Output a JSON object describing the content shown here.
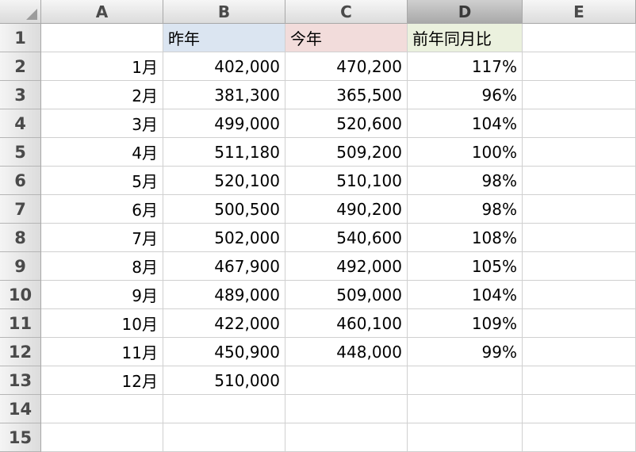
{
  "columns": [
    "A",
    "B",
    "C",
    "D",
    "E"
  ],
  "selected_column": "D",
  "header_row": {
    "a": "",
    "b": "昨年",
    "c": "今年",
    "d": "前年同月比",
    "e": ""
  },
  "header_fills": {
    "b": "#dbe5f1",
    "c": "#f2dcdb",
    "d": "#ebf1de"
  },
  "rows": [
    {
      "num": "2",
      "month": "1月",
      "last_year": "402,000",
      "this_year": "470,200",
      "yoy": "117%"
    },
    {
      "num": "3",
      "month": "2月",
      "last_year": "381,300",
      "this_year": "365,500",
      "yoy": "96%"
    },
    {
      "num": "4",
      "month": "3月",
      "last_year": "499,000",
      "this_year": "520,600",
      "yoy": "104%"
    },
    {
      "num": "5",
      "month": "4月",
      "last_year": "511,180",
      "this_year": "509,200",
      "yoy": "100%"
    },
    {
      "num": "6",
      "month": "5月",
      "last_year": "520,100",
      "this_year": "510,100",
      "yoy": "98%"
    },
    {
      "num": "7",
      "month": "6月",
      "last_year": "500,500",
      "this_year": "490,200",
      "yoy": "98%"
    },
    {
      "num": "8",
      "month": "7月",
      "last_year": "502,000",
      "this_year": "540,600",
      "yoy": "108%"
    },
    {
      "num": "9",
      "month": "8月",
      "last_year": "467,900",
      "this_year": "492,000",
      "yoy": "105%"
    },
    {
      "num": "10",
      "month": "9月",
      "last_year": "489,000",
      "this_year": "509,000",
      "yoy": "104%"
    },
    {
      "num": "11",
      "month": "10月",
      "last_year": "422,000",
      "this_year": "460,100",
      "yoy": "109%"
    },
    {
      "num": "12",
      "month": "11月",
      "last_year": "450,900",
      "this_year": "448,000",
      "yoy": "99%"
    },
    {
      "num": "13",
      "month": "12月",
      "last_year": "510,000",
      "this_year": "",
      "yoy": ""
    },
    {
      "num": "14",
      "month": "",
      "last_year": "",
      "this_year": "",
      "yoy": ""
    },
    {
      "num": "15",
      "month": "",
      "last_year": "",
      "this_year": "",
      "yoy": ""
    }
  ]
}
